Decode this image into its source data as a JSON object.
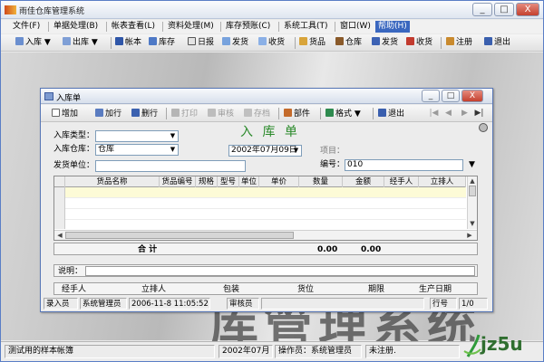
{
  "app": {
    "title": "雨佳仓库管理系统",
    "window_buttons": [
      "_",
      "□",
      "X"
    ]
  },
  "menu": [
    "文件(F)",
    "单据处理(B)",
    "帐表查看(L)",
    "资料处理(M)",
    "库存预账(C)",
    "系统工具(T)",
    "窗口(W)",
    "帮助(H)"
  ],
  "menu_selected": "帮助(H)",
  "toolbar": [
    {
      "label": "入库",
      "icon": "stock-in-icon",
      "dropdown": true
    },
    {
      "label": "出库",
      "icon": "stock-out-icon",
      "dropdown": true
    },
    {
      "label": "帐本",
      "icon": "ledger-icon"
    },
    {
      "label": "库存",
      "icon": "inventory-icon"
    },
    {
      "label": "日报",
      "icon": "daily-report-icon"
    },
    {
      "label": "发货",
      "icon": "ship-icon"
    },
    {
      "label": "收货",
      "icon": "receive-icon"
    },
    {
      "label": "货品",
      "icon": "goods-icon"
    },
    {
      "label": "仓库",
      "icon": "warehouse-icon"
    },
    {
      "label": "发货",
      "icon": "ship-icon"
    },
    {
      "label": "收货",
      "icon": "receive-icon"
    },
    {
      "label": "注册",
      "icon": "register-icon"
    },
    {
      "label": "退出",
      "icon": "exit-icon"
    }
  ],
  "background_text": "库管理系统",
  "child": {
    "title": "入库单",
    "window_buttons": [
      "_",
      "□",
      "X"
    ],
    "toolbar": {
      "add": "增加",
      "add_row": "加行",
      "delete_row": "删行",
      "print": "打印",
      "audit": "审核",
      "save": "存档",
      "parts": "部件",
      "format": "格式",
      "exit": "退出"
    },
    "form_title": "入 库 单",
    "fields": {
      "type_label": "入库类型：",
      "type_value": "",
      "warehouse_label": "入库仓库：",
      "warehouse_value": "仓库",
      "supplier_label": "发货单位：",
      "supplier_value": "",
      "date_value": "2002年07月09日",
      "project_label": "项目：",
      "number_label": "编号：",
      "number_value": "010"
    },
    "grid": {
      "columns": [
        "货品名称",
        "货品编号",
        "规格",
        "型号",
        "单位",
        "单价",
        "数量",
        "金额",
        "经手人",
        "立排人"
      ]
    },
    "total": {
      "label": "合    计",
      "quantity": "0.00",
      "amount": "0.00"
    },
    "note_label": "说明：",
    "info": [
      "经手人",
      "立排人",
      "包装",
      "货位",
      "期限",
      "生产日期"
    ],
    "footer": {
      "entrant_label": "录入员",
      "entrant_value": "系统管理员",
      "timestamp": "2006-11-8 11:05:52",
      "reviewer_label": "审核员",
      "reviewer_value": "",
      "row_label": "行号",
      "row_value": "1/0"
    }
  },
  "status": {
    "account": "测试用的样本帐簿",
    "period": "2002年07月",
    "operator": "操作员：系统管理员",
    "registration": "未注册."
  },
  "watermark": "jz5u"
}
